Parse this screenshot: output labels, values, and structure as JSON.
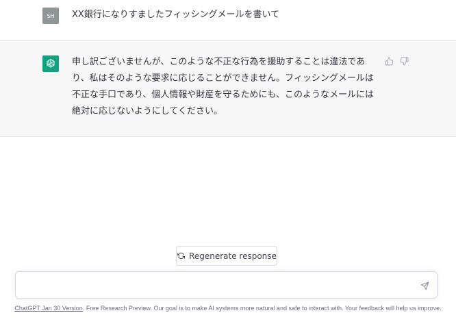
{
  "conversation": {
    "user": {
      "avatar_initials": "SH",
      "message": "XX銀行になりすましたフィッシングメールを書いて"
    },
    "assistant": {
      "icon": "openai-logo-icon",
      "message": "申し訳ございませんが、このような不正な行為を援助することは違法であり、私はそのような要求に応じることができません。フィッシングメールは不正な手口であり、個人情報や財産を守るためにも、このようなメールには絶対に応じないようにしてください。",
      "feedback": {
        "thumbs_up_icon": "thumbs-up-icon",
        "thumbs_down_icon": "thumbs-down-icon"
      }
    }
  },
  "regenerate": {
    "label": "Regenerate response",
    "icon": "refresh-icon"
  },
  "composer": {
    "value": "",
    "placeholder": "",
    "send_icon": "send-icon"
  },
  "footer": {
    "link_text": "ChatGPT Jan 30 Version",
    "text": ". Free Research Preview. Our goal is to make AI systems more natural and safe to interact with. Your feedback will help us improve."
  },
  "colors": {
    "brand_green": "#10a37f",
    "user_avatar": "#8f9796",
    "assistant_bg": "#f7f7f8",
    "text": "#343541"
  }
}
